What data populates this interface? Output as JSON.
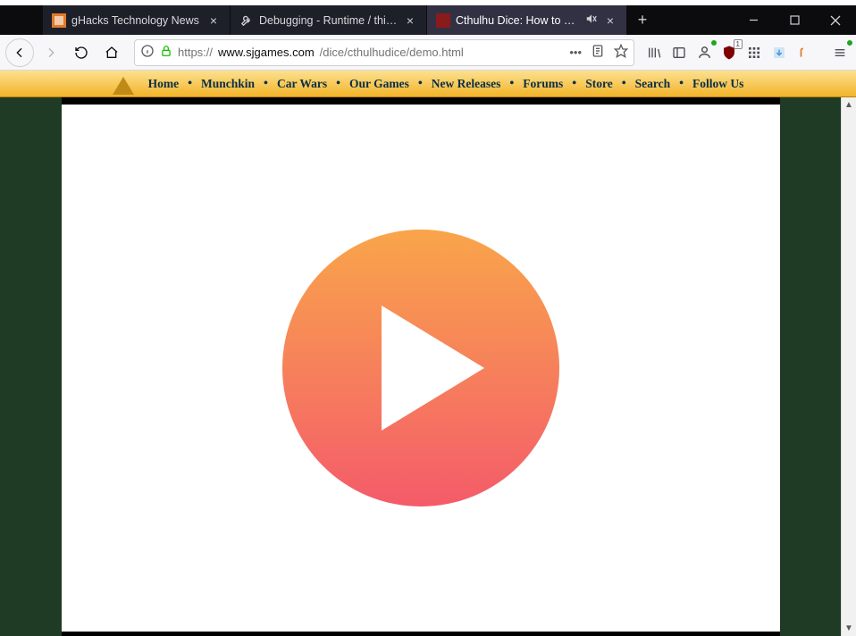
{
  "tabs": [
    {
      "label": "gHacks Technology News",
      "active": false,
      "favicon": "gh"
    },
    {
      "label": "Debugging - Runtime / this-fir",
      "active": false,
      "favicon": "wrench"
    },
    {
      "label": "Cthulhu Dice: How to Play",
      "active": true,
      "favicon": "red",
      "muted": true
    }
  ],
  "url": {
    "scheme": "https://",
    "host": "www.sjgames.com",
    "path": "/dice/cthulhudice/demo.html"
  },
  "nav": {
    "logo": "pyramid",
    "items": [
      "Home",
      "Munchkin",
      "Car Wars",
      "Our Games",
      "New Releases",
      "Forums",
      "Store",
      "Search",
      "Follow Us"
    ]
  },
  "toolbar_ext_badge": "1",
  "player": {
    "state": "paused"
  }
}
